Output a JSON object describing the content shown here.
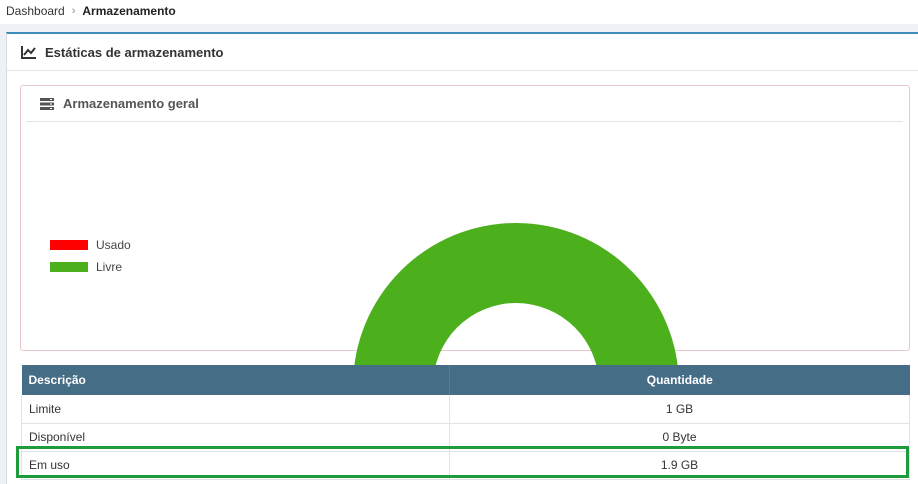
{
  "breadcrumb": {
    "items": [
      "Dashboard",
      "Armazenamento"
    ]
  },
  "panel": {
    "title": "Estáticas de armazenamento",
    "icon": "line-chart-icon"
  },
  "subpanel": {
    "title": "Armazenamento geral",
    "icon": "server-icon"
  },
  "chart_data": {
    "type": "pie",
    "shape": "semi-donut",
    "categories": [
      "Usado",
      "Livre"
    ],
    "values": [
      0,
      1
    ],
    "colors": [
      "#ff0000",
      "#4caf1c"
    ],
    "legend_position": "left"
  },
  "table": {
    "headers": [
      "Descrição",
      "Quantidade"
    ],
    "rows": [
      [
        "Limite",
        "1 GB"
      ],
      [
        "Disponível",
        "0 Byte"
      ],
      [
        "Em uso",
        "1.9 GB"
      ]
    ],
    "highlighted_row": 2
  },
  "colors": {
    "accent": "#3c8dbc",
    "table_header": "#466d86",
    "highlight": "#1e9c3c",
    "used": "#ff0000",
    "free": "#4caf1c"
  }
}
